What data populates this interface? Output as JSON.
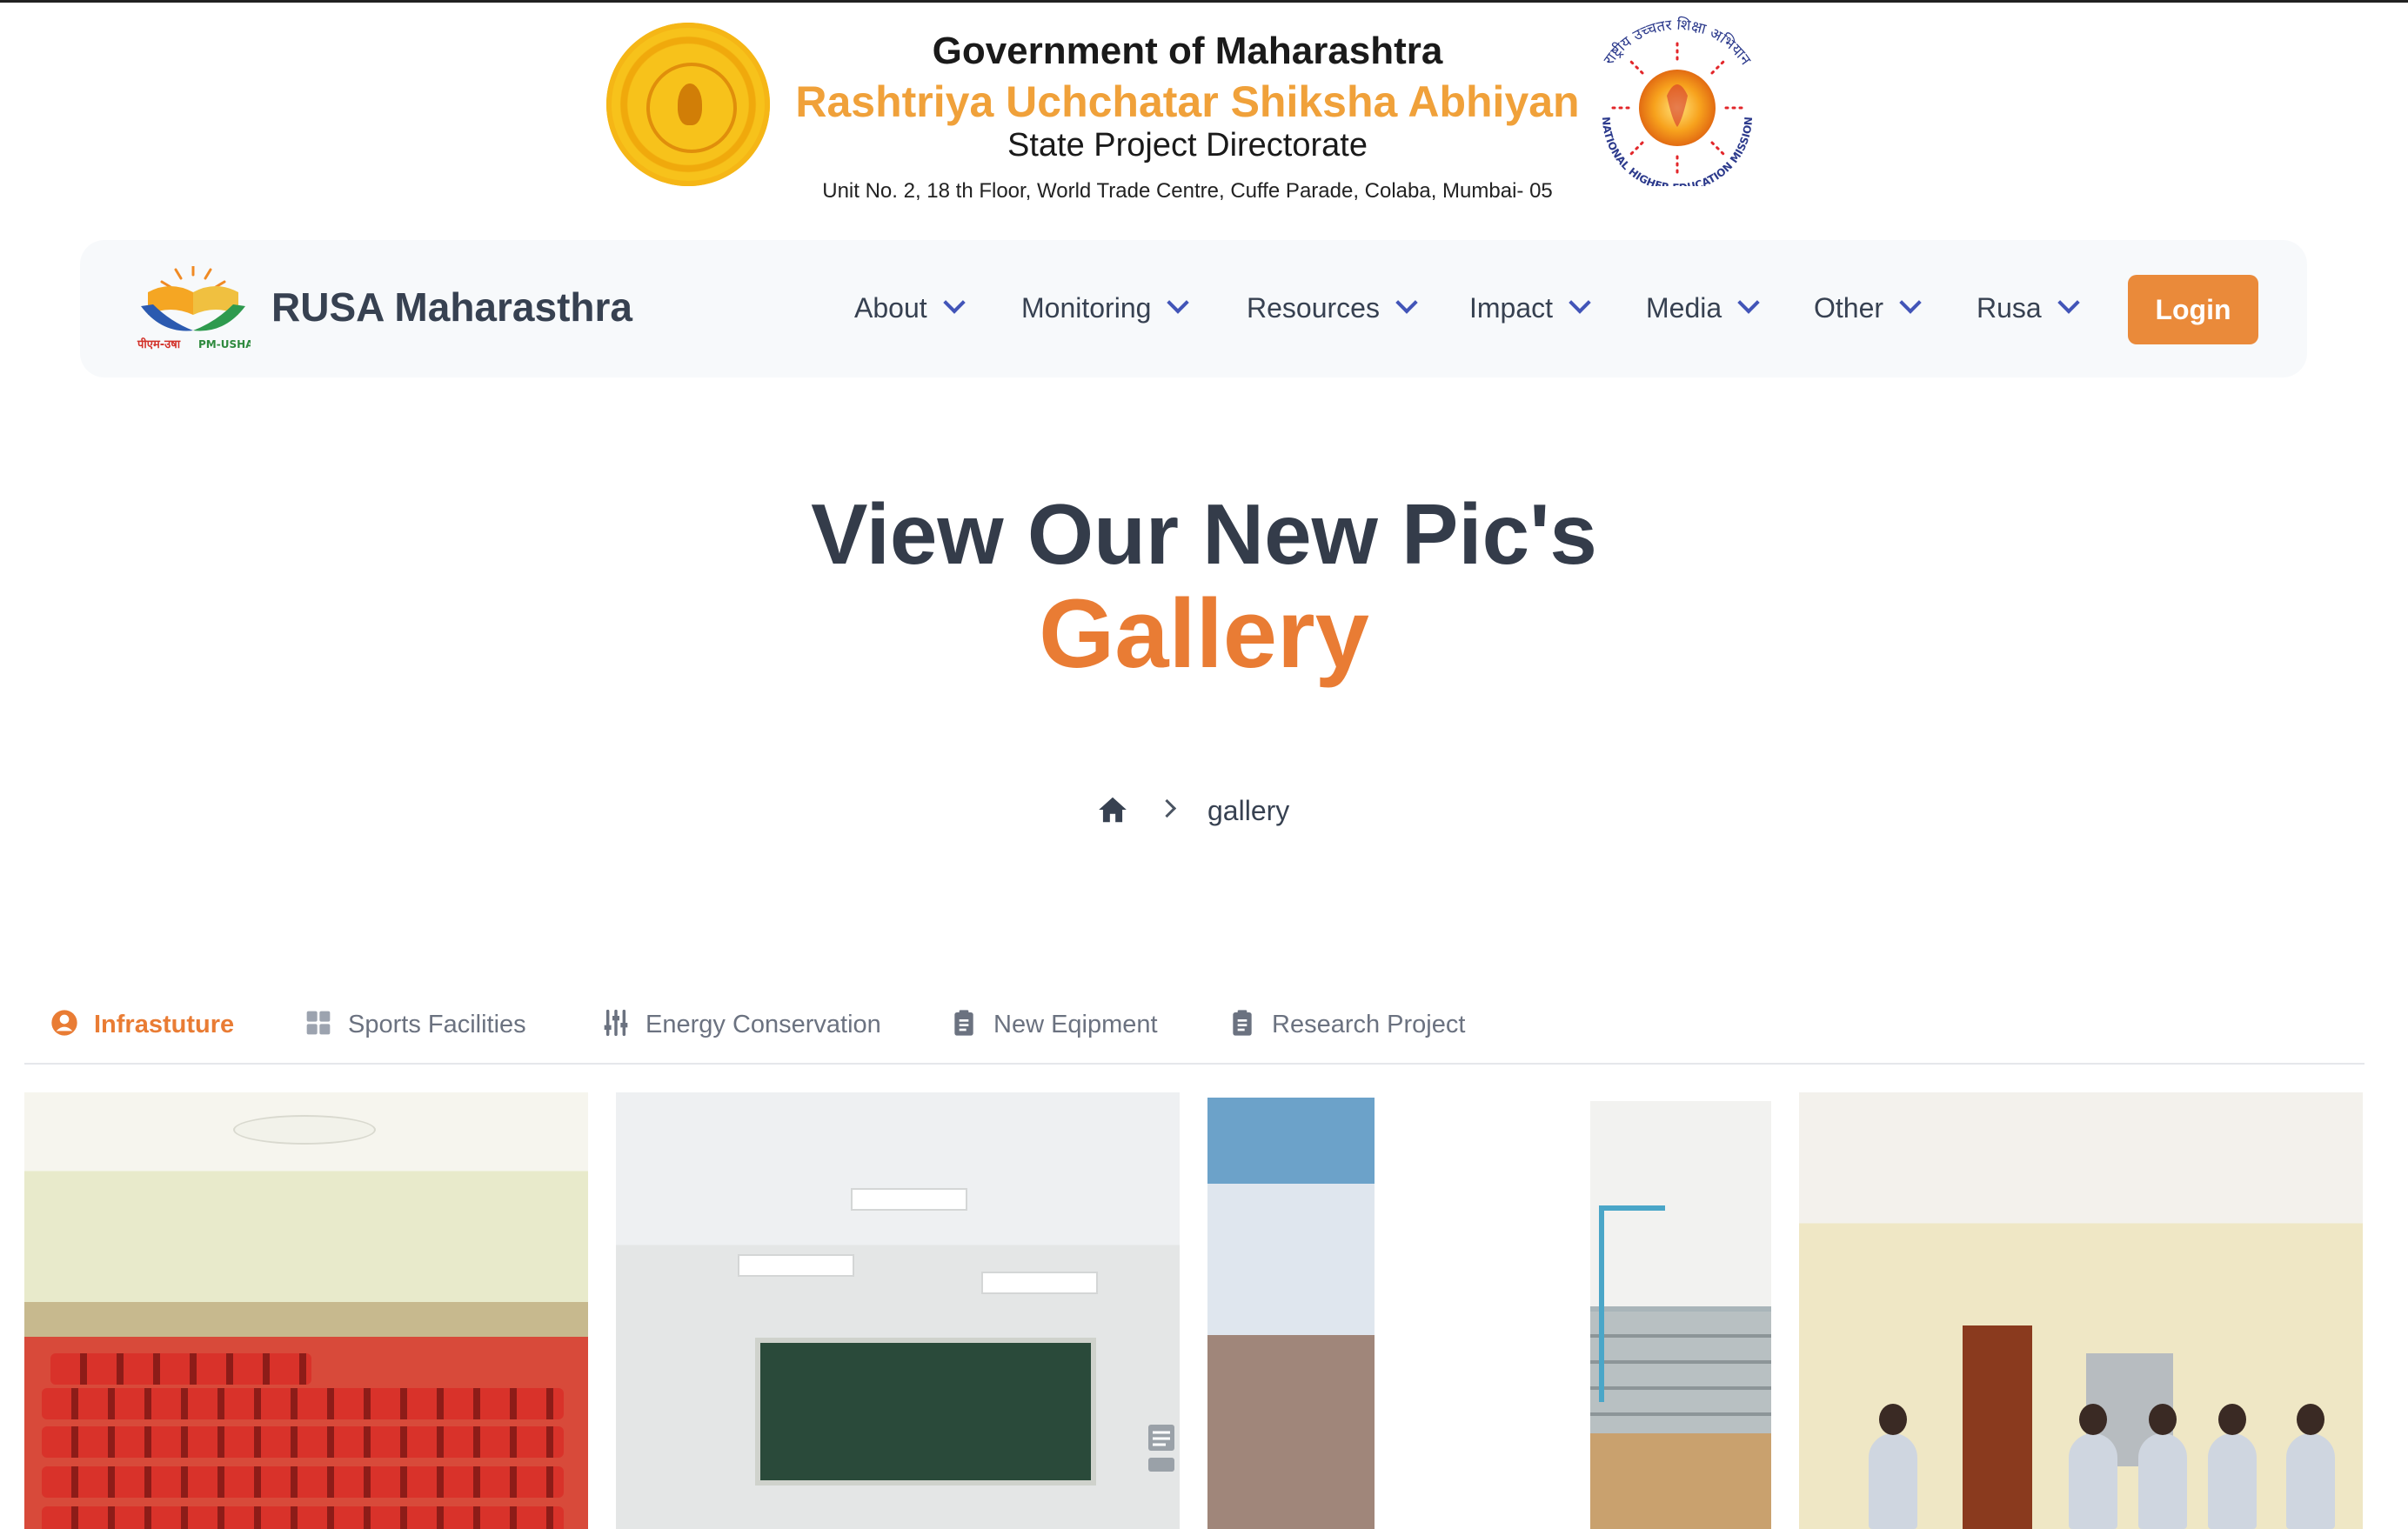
{
  "header": {
    "gov_title": "Government of Maharashtra",
    "rusa_title": "Rashtriya Uchchatar Shiksha Abhiyan",
    "spd_title": "State Project Directorate",
    "address": "Unit No. 2, 18 th Floor, World Trade Centre, Cuffe Parade, Colaba, Mumbai- 05",
    "nhem_ring_text": "राष्ट्रीय उच्चतर शिक्षा अभियान",
    "nhem_bottom_text": "NATIONAL HIGHER EDUCATION MISSION"
  },
  "navbar": {
    "brand_name": "RUSA Maharasthra",
    "brand_logo_text_left": "पीएम-उषा",
    "brand_logo_text_right": "PM-USHA",
    "items": [
      {
        "label": "About"
      },
      {
        "label": "Monitoring"
      },
      {
        "label": "Resources"
      },
      {
        "label": "Impact"
      },
      {
        "label": "Media"
      },
      {
        "label": "Other"
      },
      {
        "label": "Rusa"
      }
    ],
    "login_label": "Login"
  },
  "hero": {
    "title": "View Our New Pic's",
    "subtitle": "Gallery"
  },
  "breadcrumb": {
    "current": "gallery"
  },
  "tabs": [
    {
      "label": "Infrastuture",
      "icon": "user-circle-icon",
      "active": true
    },
    {
      "label": "Sports Facilities",
      "icon": "grid-icon",
      "active": false
    },
    {
      "label": "Energy Conservation",
      "icon": "sliders-icon",
      "active": false
    },
    {
      "label": "New Eqipment",
      "icon": "clipboard-icon",
      "active": false
    },
    {
      "label": "Research Project",
      "icon": "clipboard-icon",
      "active": false
    }
  ],
  "colors": {
    "accent": "#e97c34",
    "heading": "#343c4a",
    "nav_chevron": "#4255b8",
    "login_bg": "#ea8a3a"
  }
}
